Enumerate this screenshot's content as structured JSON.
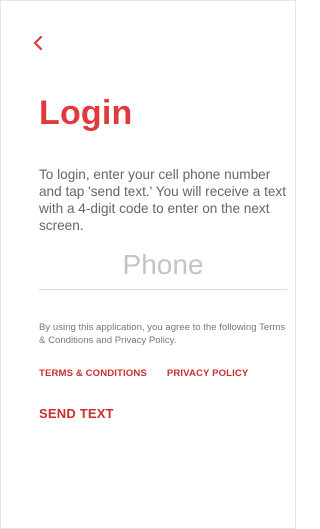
{
  "nav": {
    "back_icon": "chevron-left-icon",
    "accent_color": "#e03a3e"
  },
  "login": {
    "title": "Login",
    "instructions": "To login, enter your cell phone number and tap 'send text.' You will receive a text with a 4-digit code to enter on the next screen.",
    "phone": {
      "value": "",
      "placeholder": "Phone"
    },
    "agreement": "By using this application, you agree to the following Terms & Conditions and Privacy Policy.",
    "links": {
      "terms": "TERMS & CONDITIONS",
      "privacy": "PRIVACY POLICY"
    },
    "send_label": "SEND TEXT"
  }
}
